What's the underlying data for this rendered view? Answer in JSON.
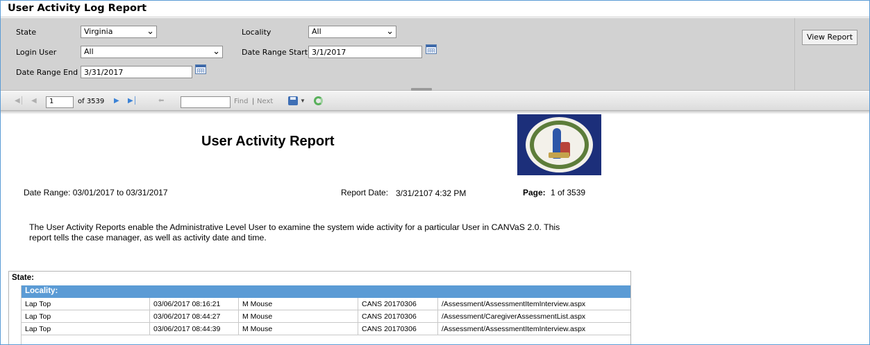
{
  "window": {
    "title": "User Activity Log Report"
  },
  "params": {
    "state_label": "State",
    "state_value": "Virginia",
    "locality_label": "Locality",
    "locality_value": "All",
    "login_user_label": "Login User",
    "login_user_value": "All",
    "date_start_label": "Date Range Start",
    "date_start_value": "3/1/2017",
    "date_end_label": "Date Range End",
    "date_end_value": "3/31/2017",
    "view_report_label": "View Report"
  },
  "toolbar": {
    "current_page": "1",
    "of_pages": "of 3539",
    "find_label": "Find",
    "separator": "|",
    "next_label": "Next"
  },
  "report": {
    "title": "User Activity Report",
    "date_range": "Date Range: 03/01/2017 to 03/31/2017",
    "report_date_label": "Report Date:",
    "report_date_value": "3/31/2107  4:32 PM",
    "page_label": "Page:",
    "page_value": "1 of 3539",
    "description": "The User Activity Reports enable the Administrative Level User to examine the system wide activity for a particular User in CANVaS 2.0. This report tells the case manager, as well as activity date and time.",
    "state_header": "State:",
    "locality_header": "Locality:",
    "rows": [
      {
        "device": "Lap Top",
        "datetime": "03/06/2017 08:16:21",
        "user": "M Mouse",
        "case": "CANS 20170306",
        "page": "/Assessment/AssessmentItemInterview.aspx"
      },
      {
        "device": "Lap Top",
        "datetime": "03/06/2017 08:44:27",
        "user": "M Mouse",
        "case": "CANS 20170306",
        "page": "/Assessment/CaregiverAssessmentList.aspx"
      },
      {
        "device": "Lap Top",
        "datetime": "03/06/2017 08:44:39",
        "user": "M Mouse",
        "case": "CANS 20170306",
        "page": "/Assessment/AssessmentItemInterview.aspx"
      }
    ]
  },
  "colors": {
    "accent_blue": "#5b9bd5",
    "params_bg": "#d2d2d2",
    "seal_bg": "#1c2f7a"
  },
  "icons": {
    "first_page": "first-page-icon",
    "prev_page": "prev-page-icon",
    "next_page": "next-page-icon",
    "last_page": "last-page-icon",
    "back": "back-icon",
    "export": "save-export-icon",
    "refresh": "refresh-icon",
    "calendar": "calendar-icon"
  }
}
